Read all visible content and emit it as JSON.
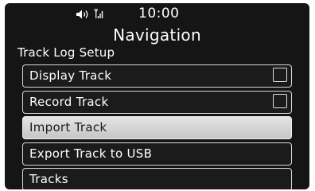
{
  "status_bar": {
    "time": "10:00",
    "icons": [
      "speaker-icon",
      "signal-icon"
    ]
  },
  "header": {
    "title": "Navigation",
    "subtitle": "Track Log Setup"
  },
  "menu": {
    "items": [
      {
        "label": "Display Track",
        "checkbox": true,
        "checked": false,
        "selected": false
      },
      {
        "label": "Record Track",
        "checkbox": true,
        "checked": false,
        "selected": false
      },
      {
        "label": "Import Track",
        "checkbox": false,
        "selected": true
      },
      {
        "label": "Export Track to USB",
        "checkbox": false,
        "selected": false
      },
      {
        "label": "Tracks",
        "checkbox": false,
        "selected": false
      }
    ]
  },
  "colors": {
    "background": "#151515",
    "border": "#d8d8d8",
    "selected_background": "#d4d4d4",
    "text": "#ffffff",
    "selected_text": "#1a1a1a"
  }
}
